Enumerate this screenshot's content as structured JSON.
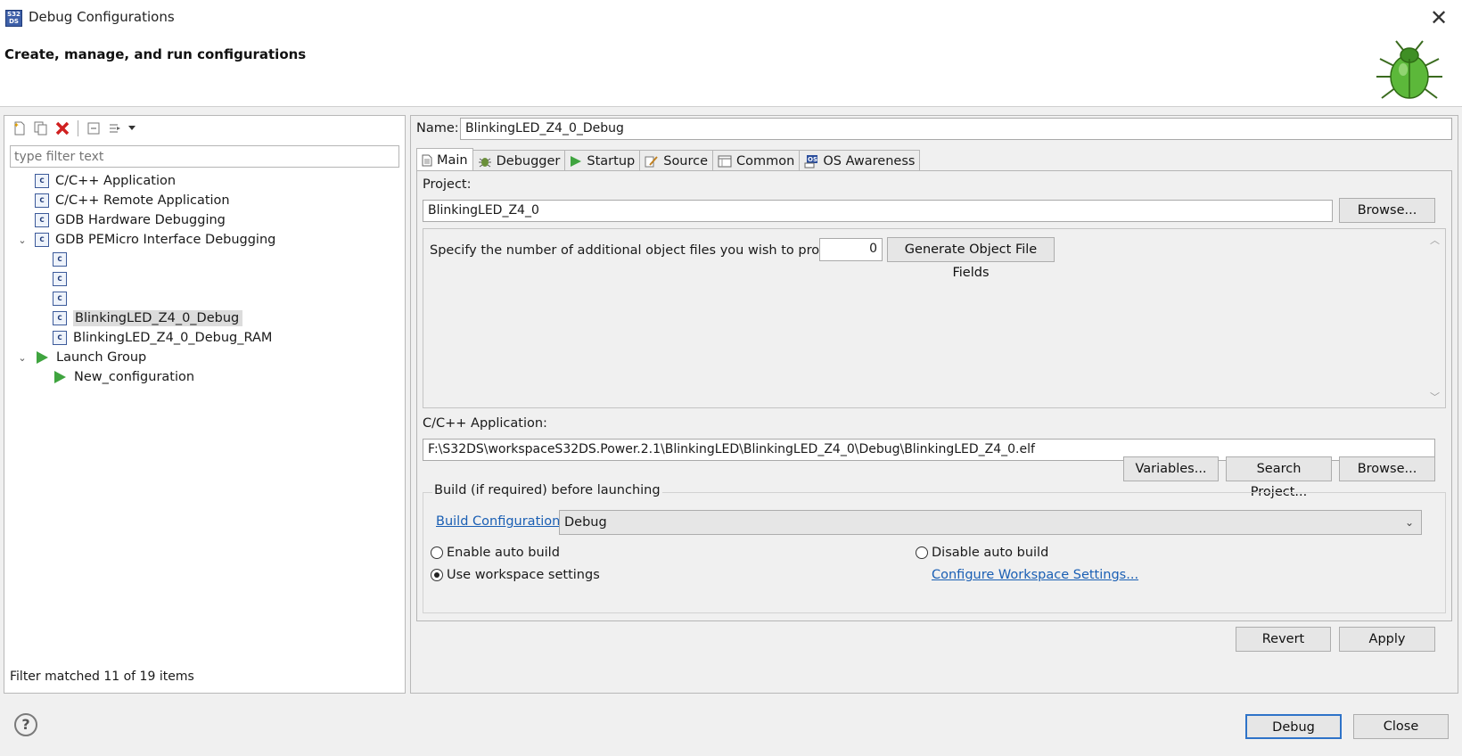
{
  "window": {
    "title": "Debug Configurations",
    "app_icon_text": "S32 DS",
    "close_glyph": "✕"
  },
  "header": {
    "title": "Create, manage, and run configurations"
  },
  "left": {
    "filter_placeholder": "type filter text",
    "tree": [
      {
        "label": "C/C++ Application",
        "icon": "c-config-icon",
        "level": 0,
        "twisty": ""
      },
      {
        "label": "C/C++ Remote Application",
        "icon": "c-config-icon",
        "level": 0,
        "twisty": ""
      },
      {
        "label": "GDB Hardware Debugging",
        "icon": "c-config-icon",
        "level": 0,
        "twisty": ""
      },
      {
        "label": "GDB PEMicro Interface Debugging",
        "icon": "c-config-icon",
        "level": 0,
        "twisty": "⌄"
      },
      {
        "label": "",
        "icon": "c-config-icon",
        "level": 1
      },
      {
        "label": "",
        "icon": "c-config-icon",
        "level": 1
      },
      {
        "label": "",
        "icon": "c-config-icon",
        "level": 1
      },
      {
        "label": "BlinkingLED_Z4_0_Debug",
        "icon": "c-config-icon",
        "level": 1,
        "selected": true
      },
      {
        "label": "BlinkingLED_Z4_0_Debug_RAM",
        "icon": "c-config-icon",
        "level": 1
      },
      {
        "label": "Launch Group",
        "icon": "launch-group-icon",
        "level": 0,
        "twisty": "⌄"
      },
      {
        "label": "New_configuration",
        "icon": "launch-group-icon",
        "level": 1
      }
    ],
    "filter_status": "Filter matched 11 of 19 items"
  },
  "right": {
    "name_label": "Name:",
    "name_value": "BlinkingLED_Z4_0_Debug",
    "tabs": [
      {
        "label": "Main",
        "icon": "main-tab-icon",
        "active": true
      },
      {
        "label": "Debugger",
        "icon": "debugger-tab-icon"
      },
      {
        "label": "Startup",
        "icon": "startup-tab-icon"
      },
      {
        "label": "Source",
        "icon": "source-tab-icon"
      },
      {
        "label": "Common",
        "icon": "common-tab-icon"
      },
      {
        "label": "OS Awareness",
        "icon": "os-tab-icon"
      }
    ],
    "project_label": "Project:",
    "project_value": "BlinkingLED_Z4_0",
    "browse_label": "Browse...",
    "objfiles_label": "Specify the number of additional object files you wish to program:",
    "objfiles_value": "0",
    "generate_label": "Generate Object File Fields",
    "app_label": "C/C++ Application:",
    "app_value": "F:\\S32DS\\workspaceS32DS.Power.2.1\\BlinkingLED\\BlinkingLED_Z4_0\\Debug\\BlinkingLED_Z4_0.elf",
    "variables_label": "Variables...",
    "search_project_label": "Search Project...",
    "browse2_label": "Browse...",
    "build_group_title": "Build (if required) before launching",
    "build_config_link": "Build Configuration:",
    "build_config_value": "Debug",
    "enable_auto_build": "Enable auto build",
    "disable_auto_build": "Disable auto build",
    "use_workspace": "Use workspace settings",
    "configure_workspace_link": "Configure Workspace Settings...",
    "revert_label": "Revert",
    "apply_label": "Apply"
  },
  "footer": {
    "help_glyph": "?",
    "debug_label": "Debug",
    "close_label": "Close"
  }
}
